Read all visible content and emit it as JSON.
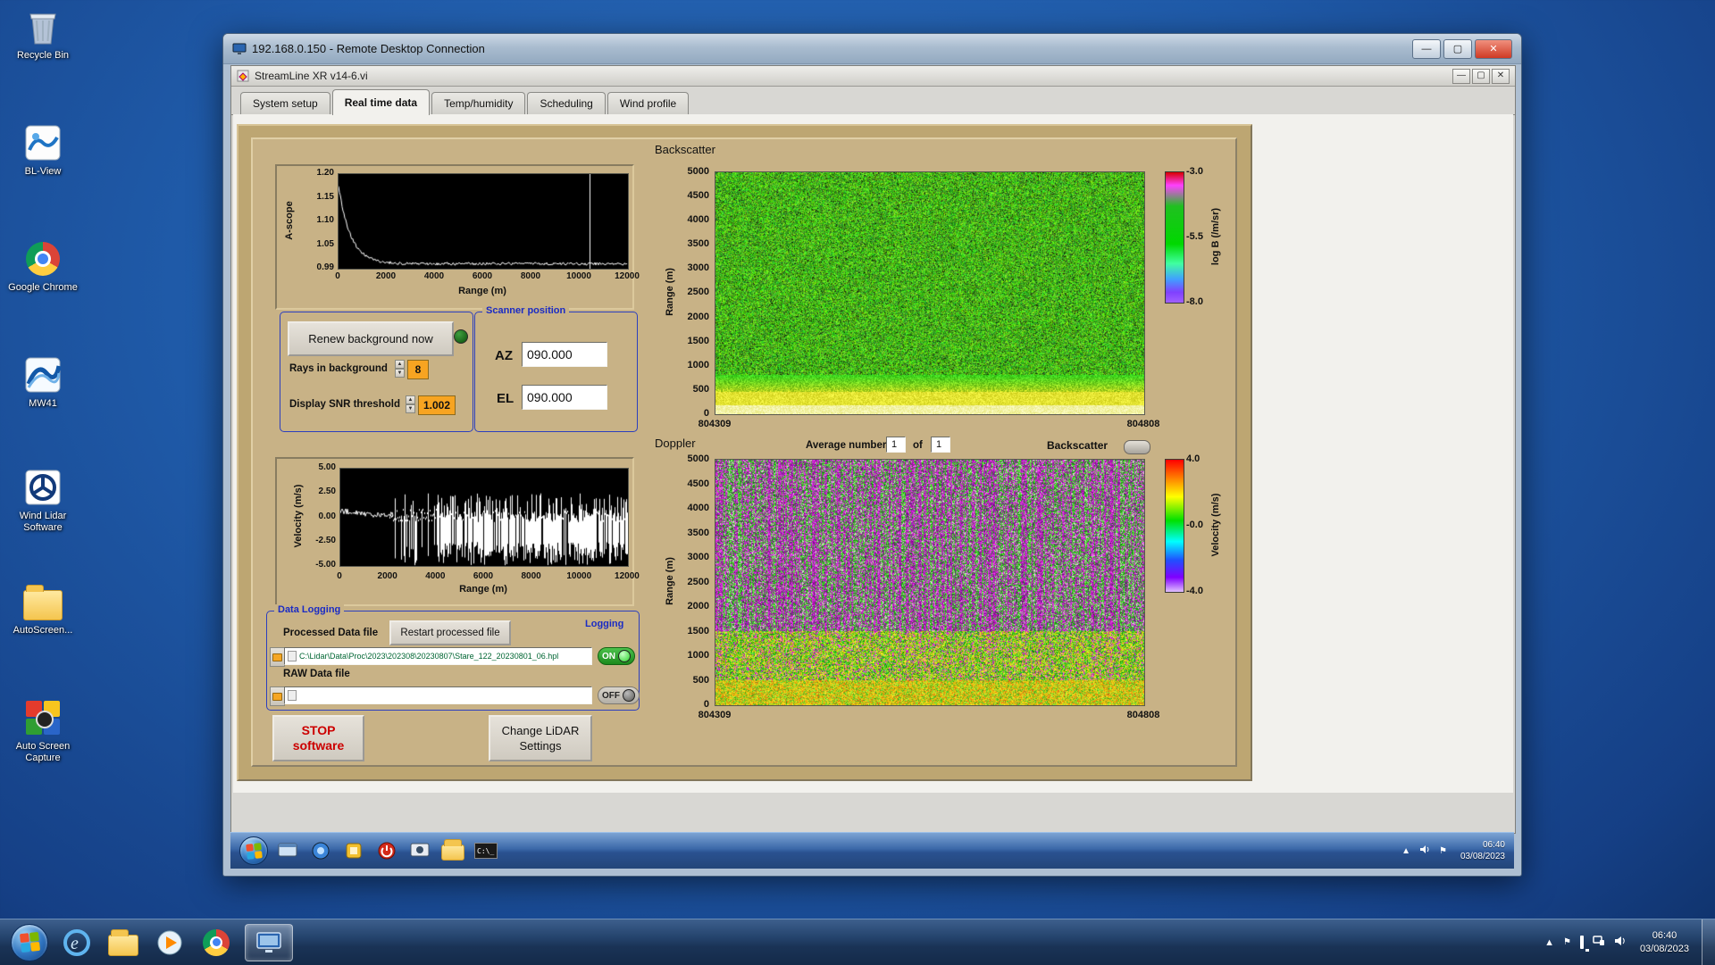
{
  "desktop": {
    "icons": [
      {
        "label": "Recycle Bin"
      },
      {
        "label": "BL-View"
      },
      {
        "label": "Google Chrome"
      },
      {
        "label": "MW41"
      },
      {
        "label": "Wind Lidar Software"
      },
      {
        "label": "AutoScreen..."
      },
      {
        "label": "Auto Screen Capture"
      }
    ]
  },
  "rdp": {
    "title": "192.168.0.150 - Remote Desktop Connection"
  },
  "app": {
    "title": "StreamLine XR v14-6.vi"
  },
  "tabs": [
    {
      "label": "System setup"
    },
    {
      "label": "Real time data"
    },
    {
      "label": "Temp/humidity"
    },
    {
      "label": "Scheduling"
    },
    {
      "label": "Wind profile"
    }
  ],
  "ascope": {
    "ylabel": "A-scope",
    "xlabel": "Range (m)",
    "yticks": [
      "1.20",
      "1.15",
      "1.10",
      "1.05",
      "0.99"
    ],
    "xticks": [
      "0",
      "2000",
      "4000",
      "6000",
      "8000",
      "10000",
      "12000"
    ]
  },
  "controls": {
    "renew_button": "Renew background now",
    "rays_label": "Rays in background",
    "rays_value": "8",
    "snr_label": "Display SNR threshold",
    "snr_value": "1.002"
  },
  "scanner": {
    "title": "Scanner position",
    "az_label": "AZ",
    "az_value": "090.000",
    "el_label": "EL",
    "el_value": "090.000"
  },
  "backscatter": {
    "title": "Backscatter",
    "ylabel": "Range (m)",
    "yticks": [
      "5000",
      "4500",
      "4000",
      "3500",
      "3000",
      "2500",
      "2000",
      "1500",
      "1000",
      "500",
      "0"
    ],
    "x_start": "804309",
    "x_end": "804808",
    "cb_ticks": [
      "-3.0",
      "-5.5",
      "-8.0"
    ],
    "cb_label": "log B (/m/sr)"
  },
  "doppler": {
    "title": "Doppler",
    "avg_label": "Average number",
    "avg_value": "1",
    "of_label": "of",
    "of_count": "1",
    "toggle_label": "Backscatter",
    "ylabel": "Range (m)",
    "yticks": [
      "5000",
      "4500",
      "4000",
      "3500",
      "3000",
      "2500",
      "2000",
      "1500",
      "1000",
      "500",
      "0"
    ],
    "x_start": "804309",
    "x_end": "804808",
    "cb_ticks": [
      "4.0",
      "-0.0",
      "-4.0"
    ],
    "cb_label": "Velocity (m/s)"
  },
  "velocity": {
    "ylabel": "Velocity (m/s)",
    "xlabel": "Range (m)",
    "yticks": [
      "5.00",
      "2.50",
      "0.00",
      "-2.50",
      "-5.00"
    ],
    "xticks": [
      "0",
      "2000",
      "4000",
      "6000",
      "8000",
      "10000",
      "12000"
    ]
  },
  "logging": {
    "title": "Data Logging",
    "processed_label": "Processed Data file",
    "restart_button": "Restart processed file",
    "logging_label": "Logging",
    "processed_path": "C:\\Lidar\\Data\\Proc\\2023\\202308\\20230807\\Stare_122_20230801_06.hpl",
    "on_label": "ON",
    "raw_label": "RAW Data file",
    "raw_path": "",
    "off_label": "OFF"
  },
  "actions": {
    "stop_line1": "STOP",
    "stop_line2": "software",
    "settings_line1": "Change LiDAR",
    "settings_line2": "Settings"
  },
  "session_taskbar": {
    "time": "06:40",
    "date": "03/08/2023",
    "cmd_label": "C:\\_"
  },
  "taskbar": {
    "time": "06:40",
    "date": "03/08/2023"
  },
  "chart_data": [
    {
      "type": "line",
      "title": "A-scope",
      "ylabel": "A-scope",
      "xlabel": "Range (m)",
      "xlim": [
        0,
        12000
      ],
      "ylim": [
        0.99,
        1.2
      ],
      "x": [
        0,
        200,
        400,
        700,
        1000,
        1500,
        2000,
        4000,
        6000,
        8000,
        10000,
        12000
      ],
      "y": [
        1.17,
        1.12,
        1.07,
        1.03,
        1.01,
        1.0,
        1.0,
        1.0,
        1.0,
        1.0,
        1.0,
        1.0
      ],
      "annotations": [
        "single full-height vertical spike near 10400 m"
      ]
    },
    {
      "type": "heatmap",
      "title": "Backscatter",
      "ylabel": "Range (m)",
      "ylim": [
        0,
        5000
      ],
      "x_range": [
        "804309",
        "804808"
      ],
      "colorbar_label": "log B (/m/sr)",
      "colorbar_range": [
        -8.0,
        -3.0
      ],
      "description": "uniform green speckle (~ -5.5) above ~700 m with sparse dark pixels; bright yellow-to-white band (stronger backscatter) below ~500 m"
    },
    {
      "type": "line",
      "title": "Velocity",
      "ylabel": "Velocity (m/s)",
      "xlabel": "Range (m)",
      "xlim": [
        0,
        12000
      ],
      "ylim": [
        -5,
        5
      ],
      "description": "noisy trace near 0 to +0.5 m/s below ~2000 m; dense full-scale vertical noise spikes (-5 to +2.5 m/s) beyond ~3000 m"
    },
    {
      "type": "heatmap",
      "title": "Doppler",
      "ylabel": "Range (m)",
      "ylim": [
        0,
        5000
      ],
      "x_range": [
        "804309",
        "804808"
      ],
      "colorbar_label": "Velocity (m/s)",
      "colorbar_range": [
        -4.0,
        4.0
      ],
      "description": "yellow/green/orange low-velocity band below ~1500 m; noisy magenta-purple and green speckle in vertical streaks above (uncorrelated noise)"
    }
  ]
}
